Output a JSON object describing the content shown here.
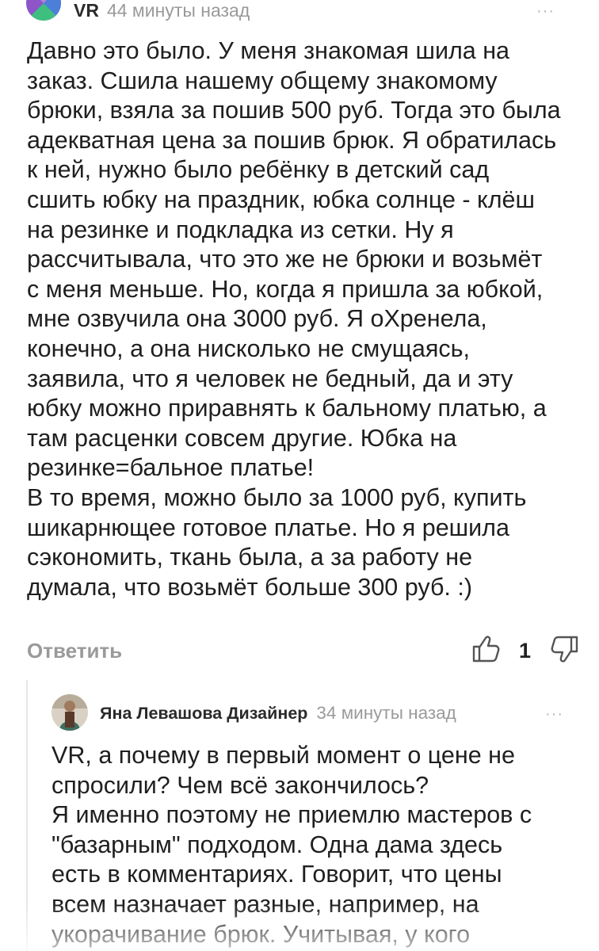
{
  "comment": {
    "author": "VR",
    "time": "44 минуты назад",
    "text": "Давно это было. У меня знакомая шила на\nзаказ. Сшила нашему общему знакомому\nбрюки, взяла за пошив 500 руб. Тогда это была\nадекватная цена за пошив брюк. Я обратилась\nк ней, нужно было ребёнку в детский сад\nсшить юбку на праздник, юбка солнце - клёш\nна резинке и подкладка из сетки. Ну я\nрассчитывала, что это же не брюки и возьмёт\nс меня меньше. Но, когда я пришла за юбкой,\nмне озвучила она 3000 руб. Я оХренела,\nконечно, а она нисколько не смущаясь,\nзаявила, что я человек не бедный, да и эту\nюбку можно приравнять к бальному платью, а\nтам расценки совсем другие. Юбка на\nрезинке=бальное платье!\nВ то время, можно было за 1000 руб, купить\nшикарнющее готовое платье. Но я решила\nсэкономить, ткань была, а за работу не\nдумала, что возьмёт больше 300 руб. :)",
    "reply_label": "Ответить",
    "like_count": "1",
    "more": "···"
  },
  "reply": {
    "author": "Яна Левашова Дизайнер",
    "time": "34 минуты назад",
    "text": "VR, а почему в первый момент о цене не\nспросили? Чем всё закончилось?\nЯ именно поэтому не приемлю мастеров с\n\"базарным\" подходом. Одна дама здесь\nесть в комментариях. Говорит, что цены\nвсем назначает разные, например, на\nукорачивание брюк. Учитывая, у кого",
    "more": "···"
  },
  "colors": {
    "avatar_purple": "#8e55c9",
    "avatar_green": "#3fbf7f",
    "avatar_blue": "#4c7fd8",
    "muted": "#9a9a9a"
  }
}
